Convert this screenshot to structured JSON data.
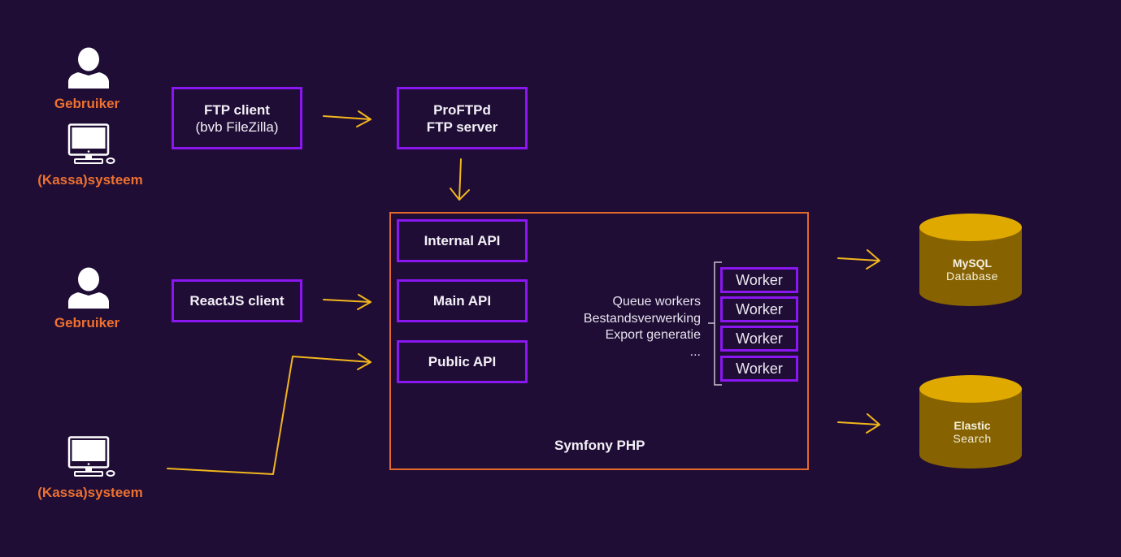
{
  "actors": [
    {
      "id": "user-top",
      "icon": "user-icon",
      "label": "Gebruiker"
    },
    {
      "id": "system-top",
      "icon": "computer-icon",
      "label": "(Kassa)systeem"
    },
    {
      "id": "user-middle",
      "icon": "user-icon",
      "label": "Gebruiker"
    },
    {
      "id": "system-bottom",
      "icon": "computer-icon",
      "label": "(Kassa)systeem"
    }
  ],
  "clients": {
    "ftp_client": {
      "title": "FTP client",
      "subtitle": "(bvb FileZilla)"
    },
    "proftpd": {
      "line1": "ProFTPd",
      "line2": "FTP server"
    },
    "react_client": {
      "title": "ReactJS client"
    }
  },
  "symfony": {
    "label": "Symfony PHP",
    "apis": [
      "Internal API",
      "Main API",
      "Public API"
    ],
    "queue_description": [
      "Queue workers",
      "Bestandsverwerking",
      "Export generatie",
      "..."
    ],
    "workers": [
      "Worker",
      "Worker",
      "Worker",
      "Worker"
    ]
  },
  "datastores": [
    {
      "title": "MySQL",
      "subtitle": "Database",
      "icon": "database-icon"
    },
    {
      "title": "Elastic",
      "subtitle": "Search",
      "icon": "database-icon"
    }
  ],
  "colors": {
    "background": "#1f0d35",
    "actor_label": "#ee7130",
    "box_border": "#8a16f0",
    "symfony_border": "#e36a2c",
    "arrow": "#f2b61c",
    "db_top": "#e0a900",
    "db_body": "#866300"
  }
}
